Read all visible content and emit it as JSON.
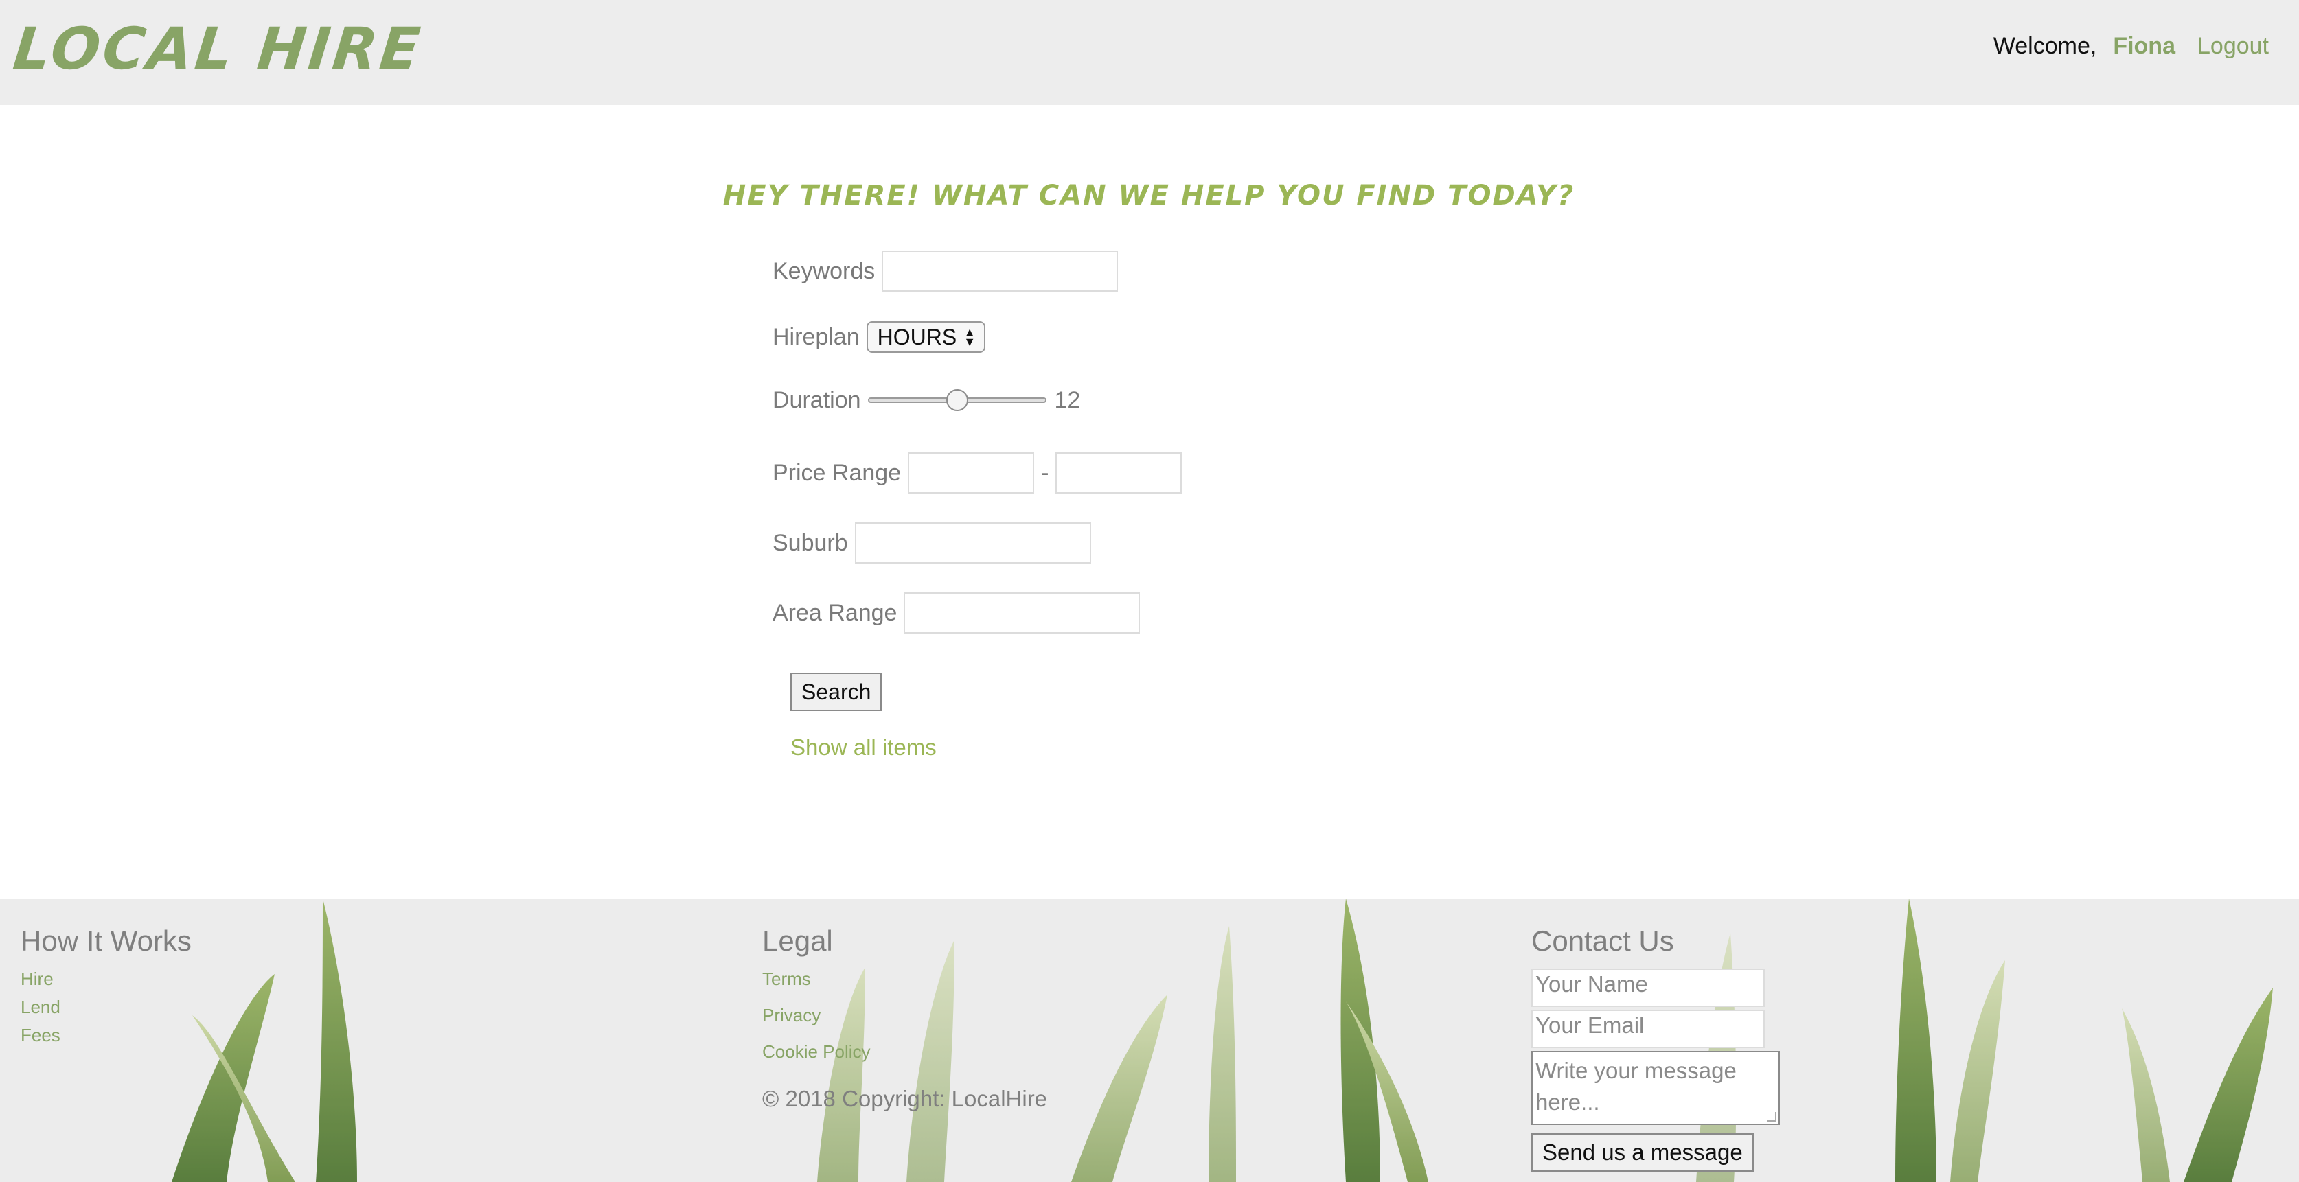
{
  "header": {
    "logo": "LOCAL HIRE",
    "welcome": "Welcome,",
    "user_name": "Fiona",
    "logout": "Logout"
  },
  "search": {
    "headline": "HEY THERE! WHAT CAN WE HELP YOU FIND TODAY?",
    "keywords_label": "Keywords",
    "keywords_value": "",
    "hireplan_label": "Hireplan",
    "hireplan_selected": "HOURS",
    "duration_label": "Duration",
    "duration_value": "12",
    "duration_fraction": 0.5,
    "price_range_label": "Price Range",
    "price_separator": "-",
    "price_min": "",
    "price_max": "",
    "suburb_label": "Suburb",
    "suburb_value": "",
    "area_range_label": "Area Range",
    "area_range_value": "",
    "search_button": "Search",
    "show_all": "Show all items"
  },
  "footer": {
    "how_it_works": {
      "title": "How It Works",
      "links": [
        "Hire",
        "Lend",
        "Fees"
      ]
    },
    "legal": {
      "title": "Legal",
      "links": [
        "Terms",
        "Privacy",
        "Cookie Policy"
      ],
      "copyright": "© 2018 Copyright: LocalHire"
    },
    "contact": {
      "title": "Contact Us",
      "name_placeholder": "Your Name",
      "email_placeholder": "Your Email",
      "message_placeholder": "Write your message here...",
      "send_button": "Send us a message"
    }
  },
  "colors": {
    "accent": "#88a466",
    "headline": "#9bb655",
    "header_bg": "#ededed",
    "footer_bg": "#ececec"
  }
}
